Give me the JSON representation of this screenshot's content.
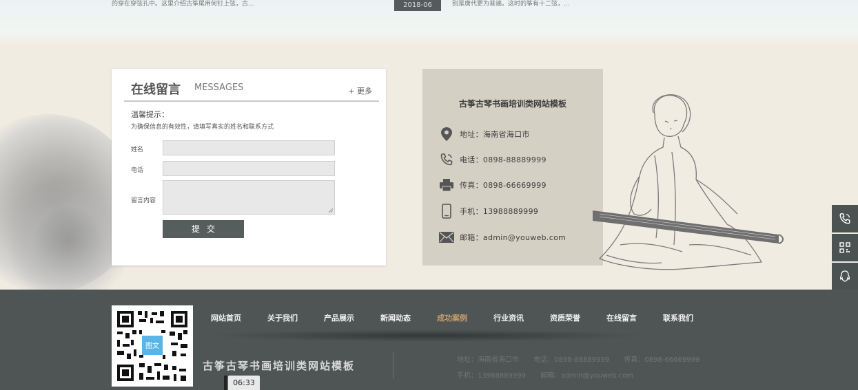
{
  "top": {
    "snippet_left": "的穿在穿弦孔中。这里介绍古筝尾用何钉上弦，古...",
    "date": "2018-06",
    "snippet_right": "别是唐代更为普遍。这时的筝有十二弦，..."
  },
  "message": {
    "title_cn": "在线留言",
    "title_en": "MESSAGES",
    "more": "+ 更多",
    "tip_title": "温馨提示：",
    "tip_text": "为确保信息的有效性，请填写真实的姓名和联系方式",
    "name_label": "姓名",
    "phone_label": "电话",
    "content_label": "留言内容",
    "submit": "提交"
  },
  "contact": {
    "title": "古筝古琴书画培训类网站模板",
    "items": [
      {
        "icon": "location-pin-icon",
        "text": "地址：海南省海口市"
      },
      {
        "icon": "phone-icon",
        "text": "电话：0898-88889999"
      },
      {
        "icon": "fax-icon",
        "text": "传真：0898-66669999"
      },
      {
        "icon": "mobile-icon",
        "text": "手机：13988889999"
      },
      {
        "icon": "mail-icon",
        "text": "邮箱：admin@youweb.com"
      }
    ]
  },
  "side_toolbar": [
    "phone-icon",
    "qr-code-icon",
    "qq-icon",
    "back-to-top-icon"
  ],
  "footer": {
    "qr_badge": "图文",
    "nav": [
      {
        "label": "网站首页",
        "active": false
      },
      {
        "label": "关于我们",
        "active": false
      },
      {
        "label": "产品展示",
        "active": false
      },
      {
        "label": "新闻动态",
        "active": false
      },
      {
        "label": "成功案例",
        "active": true
      },
      {
        "label": "行业资讯",
        "active": false
      },
      {
        "label": "资质荣誉",
        "active": false
      },
      {
        "label": "在线留言",
        "active": false
      },
      {
        "label": "联系我们",
        "active": false
      }
    ],
    "brand": "古筝古琴书画培训类网站模板",
    "info_line1": [
      "地址：海南省海口市",
      "电话：0898-88889999",
      "传真：0898-66669999"
    ],
    "info_line2": [
      "手机：13988889999",
      "邮箱：admin@youweb.com"
    ]
  },
  "video": {
    "time": "06:33"
  },
  "colors": {
    "footer_bg": "#4f5555",
    "nav_active": "#c9a06a",
    "panel_bg": "#d5d0c4",
    "button_bg": "#555d5d"
  }
}
